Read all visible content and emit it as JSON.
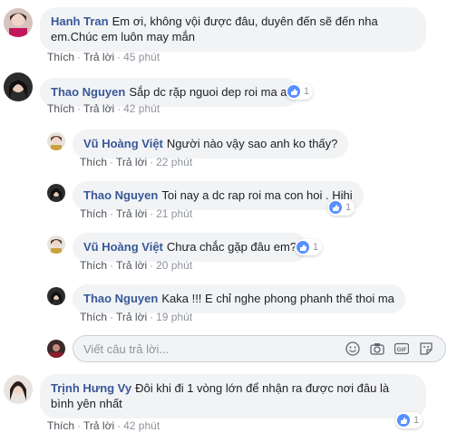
{
  "comments": [
    {
      "author": "Hanh Tran",
      "text": "Em ơi, không vội được đâu, duyên đến sẽ đến nha em.Chúc em luôn may mắn",
      "like": "Thích",
      "reply": "Trả lời",
      "time": "45 phút"
    },
    {
      "author": "Thao Nguyen",
      "text": "Sắp dc rặp nguoi dep roi ma a",
      "like": "Thích",
      "reply": "Trả lời",
      "time": "42 phút",
      "reactions": "1"
    },
    {
      "author": "Vũ Hoàng Việt",
      "text": "Người nào vậy sao anh ko thấy?",
      "like": "Thích",
      "reply": "Trả lời",
      "time": "22 phút"
    },
    {
      "author": "Thao Nguyen",
      "text": "Toi nay a dc rap roi ma con hoi . Hihi",
      "like": "Thích",
      "reply": "Trả lời",
      "time": "21 phút",
      "reactions": "1"
    },
    {
      "author": "Vũ Hoàng Việt",
      "text": "Chưa chắc gặp đâu em?",
      "like": "Thích",
      "reply": "Trả lời",
      "time": "20 phút",
      "reactions": "1"
    },
    {
      "author": "Thao Nguyen",
      "text": "Kaka !!! E chỉ nghe phong phanh thế thoi ma",
      "like": "Thích",
      "reply": "Trả lời",
      "time": "19 phút"
    },
    {
      "author": "Trịnh Hưng Vy",
      "text": "Đôi khi đi 1 vòng lớn để nhận ra được nơi đâu là bình yên nhất",
      "like": "Thích",
      "reply": "Trả lời",
      "time": "42 phút",
      "reactions": "1"
    }
  ],
  "reply_box": {
    "placeholder": "Viết câu trả lời..."
  },
  "tools": [
    "emoji-icon",
    "camera-icon",
    "gif-icon",
    "sticker-icon"
  ],
  "colors": {
    "author": "#385898",
    "bubble": "#f2f3f5",
    "like": "#5890ff"
  }
}
